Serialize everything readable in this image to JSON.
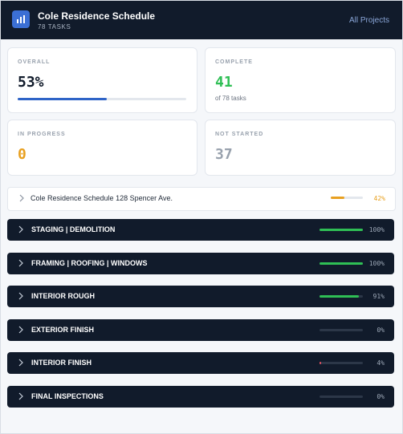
{
  "header": {
    "title": "Cole Residence Schedule",
    "subtitle": "78 TASKS",
    "nav_link": "All Projects",
    "icon": "bar-chart-icon"
  },
  "stats": {
    "overall": {
      "label": "OVERALL",
      "value": "53%",
      "progress": 0.53
    },
    "complete": {
      "label": "COMPLETE",
      "value": "41",
      "note": "of 78 tasks"
    },
    "in_progress": {
      "label": "IN PROGRESS",
      "value": "0"
    },
    "not_started": {
      "label": "NOT STARTED",
      "value": "37"
    }
  },
  "project": {
    "name": "Cole Residence Schedule 128 Spencer Ave.",
    "percent": "42%",
    "progress": 0.42
  },
  "phases": [
    {
      "name": "STAGING | DEMOLITION",
      "percent": "100%",
      "progress": 1.0
    },
    {
      "name": "FRAMING | ROOFING | WINDOWS",
      "percent": "100%",
      "progress": 1.0
    },
    {
      "name": "INTERIOR ROUGH",
      "percent": "91%",
      "progress": 0.91
    },
    {
      "name": "EXTERIOR FINISH",
      "percent": "0%",
      "progress": 0.0
    },
    {
      "name": "INTERIOR FINISH",
      "percent": "4%",
      "progress": 0.04
    },
    {
      "name": "FINAL INSPECTIONS",
      "percent": "0%",
      "progress": 0.0
    }
  ],
  "colors": {
    "header_bg": "#111b2b",
    "accent_blue": "#2f64c7",
    "complete_green": "#2fbf55",
    "in_progress_orange": "#e8a020",
    "not_started_gray": "#98a1ad",
    "low_progress_red": "#e05060"
  }
}
